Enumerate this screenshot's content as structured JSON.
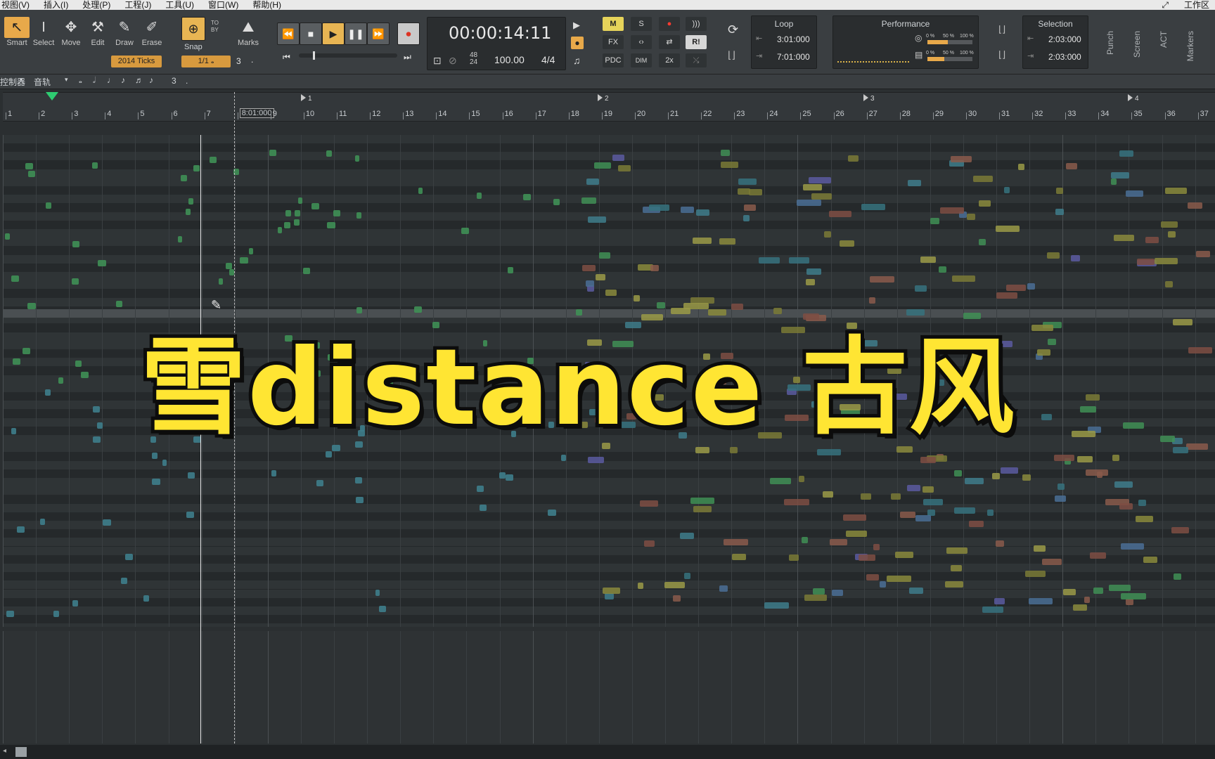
{
  "menu": [
    "视图(V)",
    "插入(I)",
    "处理(P)",
    "工程(J)",
    "工具(U)",
    "窗口(W)",
    "帮助(H)"
  ],
  "menu_right": [
    "工作区"
  ],
  "tools": [
    {
      "label": "Smart",
      "icon": "smart-arrow-icon",
      "glyph": "↖",
      "active": true
    },
    {
      "label": "Select",
      "icon": "select-ibeam-icon",
      "glyph": "I",
      "active": false
    },
    {
      "label": "Move",
      "icon": "move-icon",
      "glyph": "✥",
      "active": false
    },
    {
      "label": "Edit",
      "icon": "edit-wrench-icon",
      "glyph": "⚒",
      "active": false
    },
    {
      "label": "Draw",
      "icon": "draw-pencil-icon",
      "glyph": "✎",
      "active": false
    },
    {
      "label": "Erase",
      "icon": "eraser-icon",
      "glyph": "✐",
      "active": false
    }
  ],
  "ticks_chip": "2014 Ticks",
  "snap": {
    "label": "Snap",
    "value": "1/1",
    "count": "3",
    "to": "TO",
    "by": "BY"
  },
  "marks_label": "Marks",
  "transport": {
    "time": "00:00:14:11",
    "rate_top": "48",
    "rate_bottom": "24",
    "tempo": "100.00",
    "meter": "4/4"
  },
  "mix": {
    "m": "M",
    "s": "S",
    "fx": "FX",
    "pdc": "PDC",
    "dim": "DIM",
    "two_x": "2x",
    "ri": "R!"
  },
  "loop": {
    "title": "Loop",
    "start": "3:01:000",
    "end": "7:01:000"
  },
  "performance": {
    "title": "Performance",
    "p0": "0 %",
    "p50": "50 %",
    "p100": "100 %",
    "cpu_fill": 0.45,
    "disk_fill": 0.38
  },
  "selection": {
    "title": "Selection",
    "start": "2:03:000",
    "end": "2:03:000"
  },
  "side_labels": [
    "Punch",
    "Screen",
    "ACT",
    "Markers"
  ],
  "toolbar2": {
    "left": "控制器",
    "track": "音轨",
    "tuplet": "3",
    "dot": "."
  },
  "ruler": {
    "numbers": [
      "1",
      "2",
      "3",
      "4",
      "5",
      "6",
      "7",
      "8:01:000",
      "9",
      "10",
      "11",
      "12",
      "13",
      "14",
      "15",
      "16",
      "17",
      "18",
      "19",
      "20",
      "21",
      "22",
      "23",
      "24",
      "25",
      "26",
      "27",
      "28",
      "29",
      "30",
      "31",
      "32",
      "33",
      "34",
      "35",
      "36",
      "37"
    ],
    "markers": [
      "1",
      "2",
      "3",
      "4"
    ]
  },
  "overlay_title": "雪distance 古风",
  "colors": {
    "accent": "#e8a94a",
    "yellow": "#ffe533",
    "playhead": "#2ecc71"
  }
}
